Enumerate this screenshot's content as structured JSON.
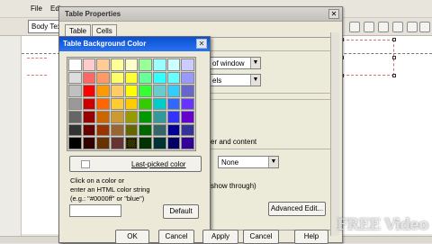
{
  "app": {
    "menu": [
      "File",
      "Edi"
    ],
    "style_value": "Body Tex"
  },
  "table_properties": {
    "title": "Table Properties",
    "tabs": [
      "Table",
      "Cells"
    ],
    "width_units": "of window",
    "height_units": "els",
    "content_text": "er and content",
    "border_value": "None",
    "show_through_text": "show through)",
    "advanced_label": "Advanced Edit...",
    "apply_label": "Apply",
    "cancel_label": "Cancel",
    "help_label": "Help"
  },
  "bg_color_dialog": {
    "title": "Table Background Color",
    "last_picked_label": "Last-picked color",
    "hint_lines": [
      "Click on a color or",
      "enter an HTML color string",
      "(e.g.: \"#0000ff\" or \"blue\")"
    ],
    "hex_value": "",
    "default_label": "Default",
    "ok_label": "OK",
    "cancel_label": "Cancel",
    "palette": [
      [
        "#ffffff",
        "#ffcccc",
        "#ffcc99",
        "#ffff99",
        "#ffffcc",
        "#99ff99",
        "#99ffff",
        "#ccffff",
        "#ccccff"
      ],
      [
        "#dddddd",
        "#ff6666",
        "#ff9966",
        "#ffff66",
        "#ffff33",
        "#66ff99",
        "#33ffff",
        "#66ffff",
        "#9999ff"
      ],
      [
        "#c0c0c0",
        "#ff0000",
        "#ff9900",
        "#ffcc66",
        "#ffff00",
        "#33ff33",
        "#66cccc",
        "#33ccff",
        "#6666cc"
      ],
      [
        "#999999",
        "#cc0000",
        "#ff6600",
        "#ffcc33",
        "#ffcc00",
        "#33cc00",
        "#00cccc",
        "#3366ff",
        "#6633ff"
      ],
      [
        "#666666",
        "#990000",
        "#cc6600",
        "#cc9933",
        "#999900",
        "#009900",
        "#339999",
        "#3333ff",
        "#6600cc"
      ],
      [
        "#333333",
        "#660000",
        "#993300",
        "#996633",
        "#666600",
        "#006600",
        "#336666",
        "#000099",
        "#333399"
      ],
      [
        "#000000",
        "#330000",
        "#663300",
        "#663333",
        "#333300",
        "#003300",
        "#003333",
        "#000066",
        "#330099"
      ]
    ],
    "selected_cell": "6-4"
  },
  "watermark": "FREE Video"
}
